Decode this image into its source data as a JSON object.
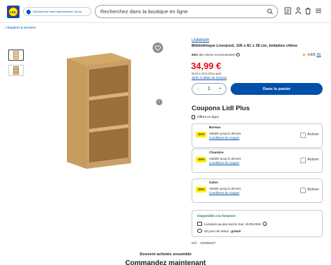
{
  "header": {
    "logo_text": "LIDL",
    "store_link": "Sélectionnez votre supermarché Lidl ou...",
    "search_placeholder": "Recherchez dans la boutique en ligne",
    "icons": [
      "search-icon",
      "shopping-list-icon",
      "account-icon",
      "cart-icon",
      "menu-icon"
    ]
  },
  "breadcrumb": "... / Étagères & armoires",
  "product": {
    "brand": "LIVARNO®",
    "title": "Bibliothèque Liverpool, 105 x 81 x 28 cm, imitation chêne",
    "recommend_pct": "94%",
    "recommend_text": "des clients recommandent",
    "rating": "4.6/5",
    "rating_count": "(8)",
    "price": "34,99 €",
    "eco_part": "Dont 2,18 € d'éco-part",
    "tarifs_link": "Tarifs et délais de livraison",
    "quantity": "1",
    "cart_button": "Dans le panier"
  },
  "coupons": {
    "title": "Coupons Lidl Plus",
    "offers_label": "Offres en ligne",
    "items": [
      {
        "name": "Bureau",
        "badge": "-20%",
        "valid": "Valable jusqu'à demain",
        "conditions": "Conditions du coupon",
        "action": "Activer"
      },
      {
        "name": "Chambre",
        "badge": "-20%",
        "valid": "Valable jusqu'à demain",
        "conditions": "Conditions du coupon",
        "action": "Activer"
      },
      {
        "name": "Salon",
        "badge": "-20%",
        "valid": "Valable jusqu'à demain",
        "conditions": "Conditions du coupon",
        "action": "Activer"
      }
    ]
  },
  "delivery": {
    "available": "Disponible à la livraison",
    "delivery_date": "Livraison au plus tard le mar. 15.09.2026",
    "returns_prefix": "30 jours de retour",
    "returns_bold": "gratuit"
  },
  "reference": "Réf. : 100096497",
  "bought_together": "Souvent achetés ensemble",
  "order_now": "Commandez maintenant",
  "colors": {
    "brand_blue": "#0050aa",
    "price_red": "#e60a14",
    "badge_yellow": "#fff000",
    "available_green": "#1a7a3c"
  }
}
